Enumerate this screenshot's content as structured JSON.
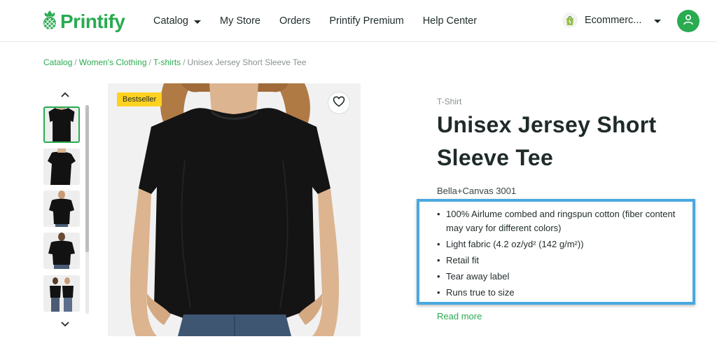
{
  "header": {
    "logo_text": "Printify",
    "nav": [
      {
        "label": "Catalog",
        "has_dropdown": true
      },
      {
        "label": "My Store",
        "has_dropdown": false
      },
      {
        "label": "Orders",
        "has_dropdown": false
      },
      {
        "label": "Printify Premium",
        "has_dropdown": false
      },
      {
        "label": "Help Center",
        "has_dropdown": false
      }
    ],
    "store_name": "Ecommerc...",
    "store_icon": "shopify-bag-icon",
    "avatar_icon": "user-icon"
  },
  "breadcrumb": {
    "items": [
      "Catalog",
      "Women's Clothing",
      "T-shirts"
    ],
    "current": "Unisex Jersey Short Sleeve Tee",
    "separator": "/"
  },
  "gallery": {
    "thumbnail_count": 5,
    "active_index": 0,
    "badge": "Bestseller",
    "favorite_icon": "heart-icon"
  },
  "product": {
    "category": "T-Shirt",
    "title": "Unisex Jersey Short Sleeve Tee",
    "brand_model": "Bella+Canvas 3001",
    "features": [
      "100% Airlume combed and ringspun cotton (fiber content may vary for different colors)",
      "Light fabric (4.2 oz/yd² (142 g/m²))",
      "Retail fit",
      "Tear away label",
      "Runs true to size"
    ],
    "read_more": "Read more"
  },
  "colors": {
    "brand_green": "#29ab51",
    "badge_yellow": "#ffd21f",
    "highlight_blue": "#4aa8e0",
    "text_dark": "#1f2a2a",
    "text_muted": "#8a9191"
  }
}
